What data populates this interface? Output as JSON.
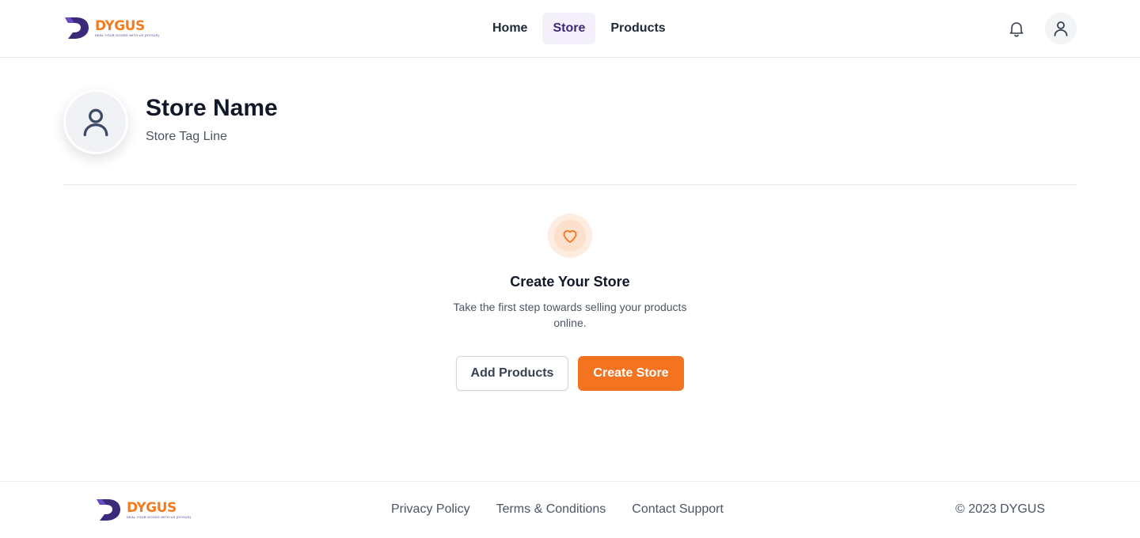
{
  "brand": {
    "name": "DYGUS",
    "tagline": "DEAL YOUR GOODS WITH US (DYGUS)",
    "primary_color": "#f47320",
    "secondary_color": "#3b2a7a"
  },
  "nav": {
    "items": [
      {
        "label": "Home",
        "active": false
      },
      {
        "label": "Store",
        "active": true
      },
      {
        "label": "Products",
        "active": false
      }
    ]
  },
  "header_icons": {
    "notifications": "bell-icon",
    "profile": "user-icon"
  },
  "store": {
    "name": "Store Name",
    "tagline": "Store Tag Line",
    "avatar_icon": "user-icon"
  },
  "empty_state": {
    "icon": "heart-icon",
    "title": "Create Your Store",
    "description": "Take the first step towards selling your products online.",
    "secondary_button": "Add Products",
    "primary_button": "Create Store"
  },
  "footer": {
    "links": [
      "Privacy Policy",
      "Terms & Conditions",
      "Contact Support"
    ],
    "copyright": "© 2023 DYGUS"
  }
}
